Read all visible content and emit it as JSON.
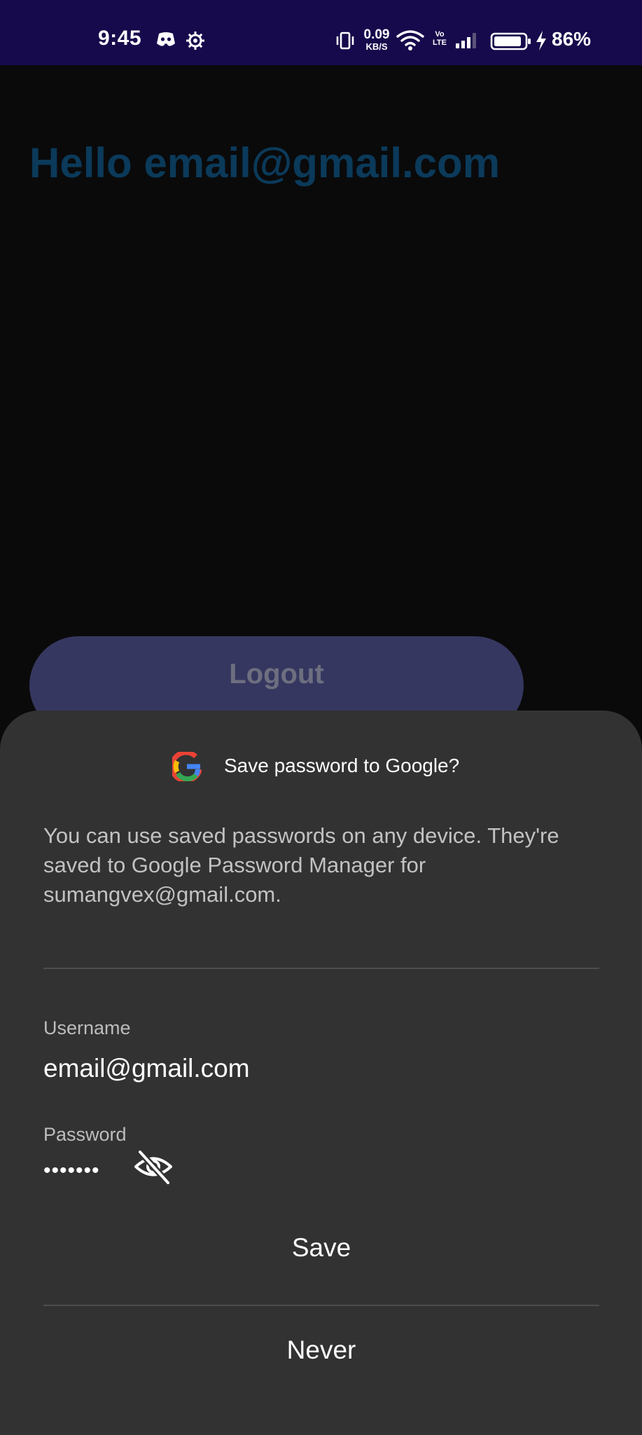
{
  "status_bar": {
    "time": "9:45",
    "net_speed_value": "0.09",
    "net_speed_unit": "KB/S",
    "volte_top": "Vo",
    "volte_bottom": "LTE",
    "battery_percent": "86%",
    "icons": [
      "discord-icon",
      "settings-gear-icon",
      "vibrate-icon",
      "wifi-icon",
      "signal-icon",
      "battery-icon",
      "charging-bolt-icon"
    ]
  },
  "app": {
    "greeting": "Hello email@gmail.com",
    "logout_label": "Logout"
  },
  "save_password_sheet": {
    "title": "Save password to Google?",
    "description": "You can use saved passwords on any device. They're saved to Google Password Manager for sumangvex@gmail.com.",
    "username_label": "Username",
    "username_value": "email@gmail.com",
    "password_label": "Password",
    "password_masked": "•••••••",
    "save_label": "Save",
    "never_label": "Never"
  },
  "colors": {
    "status_bar": "#170a4c",
    "app_background": "#0a0a0b",
    "greeting_text": "#0b3a5a",
    "logout_button": "#363760",
    "sheet_background": "#323232"
  }
}
